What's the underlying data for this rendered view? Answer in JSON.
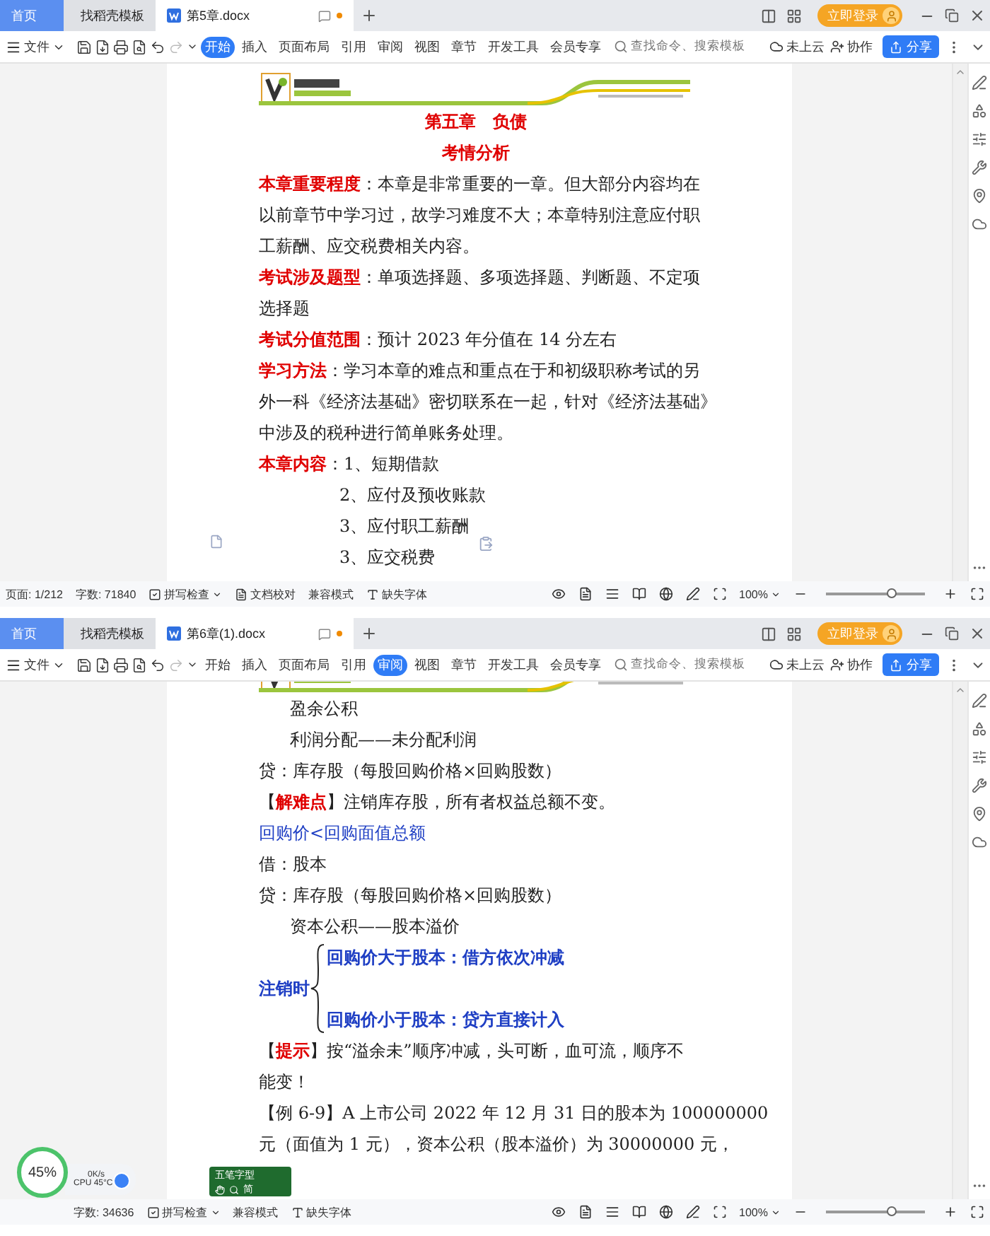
{
  "windows": [
    {
      "tabs": [
        {
          "kind": "home",
          "label": "首页",
          "selected": false
        },
        {
          "kind": "template",
          "label": "找稻壳模板",
          "selected": false
        },
        {
          "kind": "document",
          "label": "第5章.docx",
          "selected": true
        }
      ],
      "account": "立即登录",
      "file_menu": "文件",
      "ribbon_tabs": [
        {
          "label": "开始",
          "selected": true
        },
        {
          "label": "插入",
          "selected": false
        },
        {
          "label": "页面布局",
          "selected": false
        },
        {
          "label": "引用",
          "selected": false
        },
        {
          "label": "审阅",
          "selected": false
        },
        {
          "label": "视图",
          "selected": false
        },
        {
          "label": "章节",
          "selected": false
        },
        {
          "label": "开发工具",
          "selected": false
        },
        {
          "label": "会员专享",
          "selected": false
        }
      ],
      "search": {
        "placeholder": "查找命令、搜索模板"
      },
      "cloud": "未上云",
      "collab": "协作",
      "share": "分享",
      "document": {
        "paste_options": true,
        "lines": [
          {
            "kind": "heading",
            "runs": [
              {
                "text": "第五章　负债",
                "color": "#e00000",
                "bold": true
              }
            ]
          },
          {
            "kind": "heading",
            "runs": [
              {
                "text": "考情分析",
                "color": "#e00000",
                "bold": true
              }
            ]
          },
          {
            "kind": "line",
            "runs": [
              {
                "text": "本章重要程度",
                "color": "#e00000",
                "bold": true
              },
              {
                "text": "：本章是非常重要的一章。但大部分内容均在",
                "color": "#222222",
                "bold": false
              }
            ]
          },
          {
            "kind": "line",
            "runs": [
              {
                "text": "以前章节中学习过，故学习难度不大；本章特别注意应付职",
                "color": "#222222",
                "bold": false
              }
            ]
          },
          {
            "kind": "line",
            "runs": [
              {
                "text": "工薪酬、应交税费相关内容。",
                "color": "#222222",
                "bold": false
              }
            ]
          },
          {
            "kind": "line",
            "runs": [
              {
                "text": "考试涉及题型",
                "color": "#e00000",
                "bold": true
              },
              {
                "text": "：单项选择题、多项选择题、判断题、不定项",
                "color": "#222222",
                "bold": false
              }
            ]
          },
          {
            "kind": "line",
            "runs": [
              {
                "text": "选择题",
                "color": "#222222",
                "bold": false
              }
            ]
          },
          {
            "kind": "line",
            "runs": [
              {
                "text": "考试分值范围",
                "color": "#e00000",
                "bold": true
              },
              {
                "text": "：预计 2023 年分值在 14 分左右",
                "color": "#222222",
                "bold": false
              }
            ]
          },
          {
            "kind": "line",
            "runs": [
              {
                "text": "学习方法",
                "color": "#e00000",
                "bold": true
              },
              {
                "text": "：学习本章的难点和重点在于和初级职称考试的另",
                "color": "#222222",
                "bold": false
              }
            ]
          },
          {
            "kind": "line",
            "runs": [
              {
                "text": "外一科《经济法基础》密切联系在一起，针对《经济法基础》",
                "color": "#222222",
                "bold": false
              }
            ]
          },
          {
            "kind": "line",
            "runs": [
              {
                "text": "中涉及的税种进行简单账务处理。",
                "color": "#222222",
                "bold": false
              }
            ]
          },
          {
            "kind": "line",
            "runs": [
              {
                "text": "本章内容",
                "color": "#e00000",
                "bold": true
              },
              {
                "text": "：1、短期借款",
                "color": "#222222",
                "bold": false
              }
            ]
          },
          {
            "kind": "list",
            "runs": [
              {
                "text": "2、应付及预收账款",
                "color": "#222222",
                "bold": false
              }
            ]
          },
          {
            "kind": "list",
            "runs": [
              {
                "text": "3、应付职工薪酬",
                "color": "#222222",
                "bold": false
              }
            ]
          },
          {
            "kind": "list",
            "runs": [
              {
                "text": "3、应交税费",
                "color": "#222222",
                "bold": false
              }
            ]
          }
        ]
      },
      "status": {
        "items": [
          {
            "kind": "plain",
            "text": "页面: 1/212"
          },
          {
            "kind": "plain",
            "text": "字数: 71840"
          },
          {
            "kind": "check",
            "text": "拼写检查"
          },
          {
            "kind": "proof",
            "text": "文档校对"
          },
          {
            "kind": "plain",
            "text": "兼容模式"
          },
          {
            "kind": "font",
            "text": "缺失字体"
          }
        ],
        "zoom": "100%",
        "level": 0.67
      }
    },
    {
      "tabs": [
        {
          "kind": "home",
          "label": "首页",
          "selected": false
        },
        {
          "kind": "template",
          "label": "找稻壳模板",
          "selected": false
        },
        {
          "kind": "document",
          "label": "第6章(1).docx",
          "selected": true
        }
      ],
      "account": "立即登录",
      "file_menu": "文件",
      "ribbon_tabs": [
        {
          "label": "开始",
          "selected": false
        },
        {
          "label": "插入",
          "selected": false
        },
        {
          "label": "页面布局",
          "selected": false
        },
        {
          "label": "引用",
          "selected": false
        },
        {
          "label": "审阅",
          "selected": true
        },
        {
          "label": "视图",
          "selected": false
        },
        {
          "label": "章节",
          "selected": false
        },
        {
          "label": "开发工具",
          "selected": false
        },
        {
          "label": "会员专享",
          "selected": false
        }
      ],
      "search": {
        "placeholder": "查找命令、搜索模板"
      },
      "cloud": "未上云",
      "collab": "协作",
      "share": "分享",
      "document": {
        "lines": [
          {
            "kind": "indented",
            "runs": [
              {
                "text": "盈余公积",
                "color": "#222222",
                "bold": false
              }
            ]
          },
          {
            "kind": "indented",
            "runs": [
              {
                "text": "利润分配——未分配利润",
                "color": "#222222",
                "bold": false
              }
            ]
          },
          {
            "kind": "line",
            "runs": [
              {
                "text": "贷：库存股（每股回购价格×回购股数）",
                "color": "#222222",
                "bold": false
              }
            ]
          },
          {
            "kind": "line",
            "runs": [
              {
                "text": "【",
                "color": "#222222",
                "bold": false
              },
              {
                "text": "解难点",
                "color": "#e00000",
                "bold": true
              },
              {
                "text": "】注销库存股，所有者权益总额不变。",
                "color": "#222222",
                "bold": false
              }
            ]
          },
          {
            "kind": "line",
            "runs": [
              {
                "text": "回购价<回购面值总额",
                "color": "#1f3fc4",
                "bold": false
              }
            ]
          },
          {
            "kind": "line",
            "runs": [
              {
                "text": "借：股本",
                "color": "#222222",
                "bold": false
              }
            ]
          },
          {
            "kind": "line",
            "runs": [
              {
                "text": "贷：库存股（每股回购价格×回购股数）",
                "color": "#222222",
                "bold": false
              }
            ]
          },
          {
            "kind": "indented",
            "runs": [
              {
                "text": "资本公积——股本溢价",
                "color": "#222222",
                "bold": false
              }
            ]
          },
          {
            "kind": "brace",
            "label": "注销时",
            "upper": "回购价大于股本：借方依次冲减",
            "lower": "回购价小于股本：贷方直接计入"
          },
          {
            "kind": "line",
            "runs": [
              {
                "text": "【",
                "color": "#222222",
                "bold": false
              },
              {
                "text": "提示",
                "color": "#e00000",
                "bold": true
              },
              {
                "text": "】按“溢余未”顺序冲减，头可断，血可流，顺序不",
                "color": "#222222",
                "bold": false
              }
            ]
          },
          {
            "kind": "line",
            "runs": [
              {
                "text": "能变！",
                "color": "#222222",
                "bold": false
              }
            ]
          },
          {
            "kind": "line",
            "runs": [
              {
                "text": "【例 6-9】A 上市公司 2022 年 12 月 31 日的股本为 100000000",
                "color": "#222222",
                "bold": false
              }
            ]
          },
          {
            "kind": "line",
            "runs": [
              {
                "text": "元（面值为 1 元），资本公积（股本溢价）为 30000000 元，",
                "color": "#222222",
                "bold": false
              }
            ]
          }
        ]
      },
      "status": {
        "items": [
          {
            "kind": "plain",
            "text": "字数: 34636"
          },
          {
            "kind": "check",
            "text": "拼写检查"
          },
          {
            "kind": "plain",
            "text": "兼容模式"
          },
          {
            "kind": "font",
            "text": "缺失字体"
          }
        ],
        "zoom": "100%",
        "level": 0.67
      },
      "overlays": {
        "cpu": {
          "percent": "45%",
          "speed": "0K/s",
          "temp": "CPU 45°C"
        },
        "ime": {
          "mode": "五笔字型",
          "charset": "简"
        }
      }
    }
  ]
}
